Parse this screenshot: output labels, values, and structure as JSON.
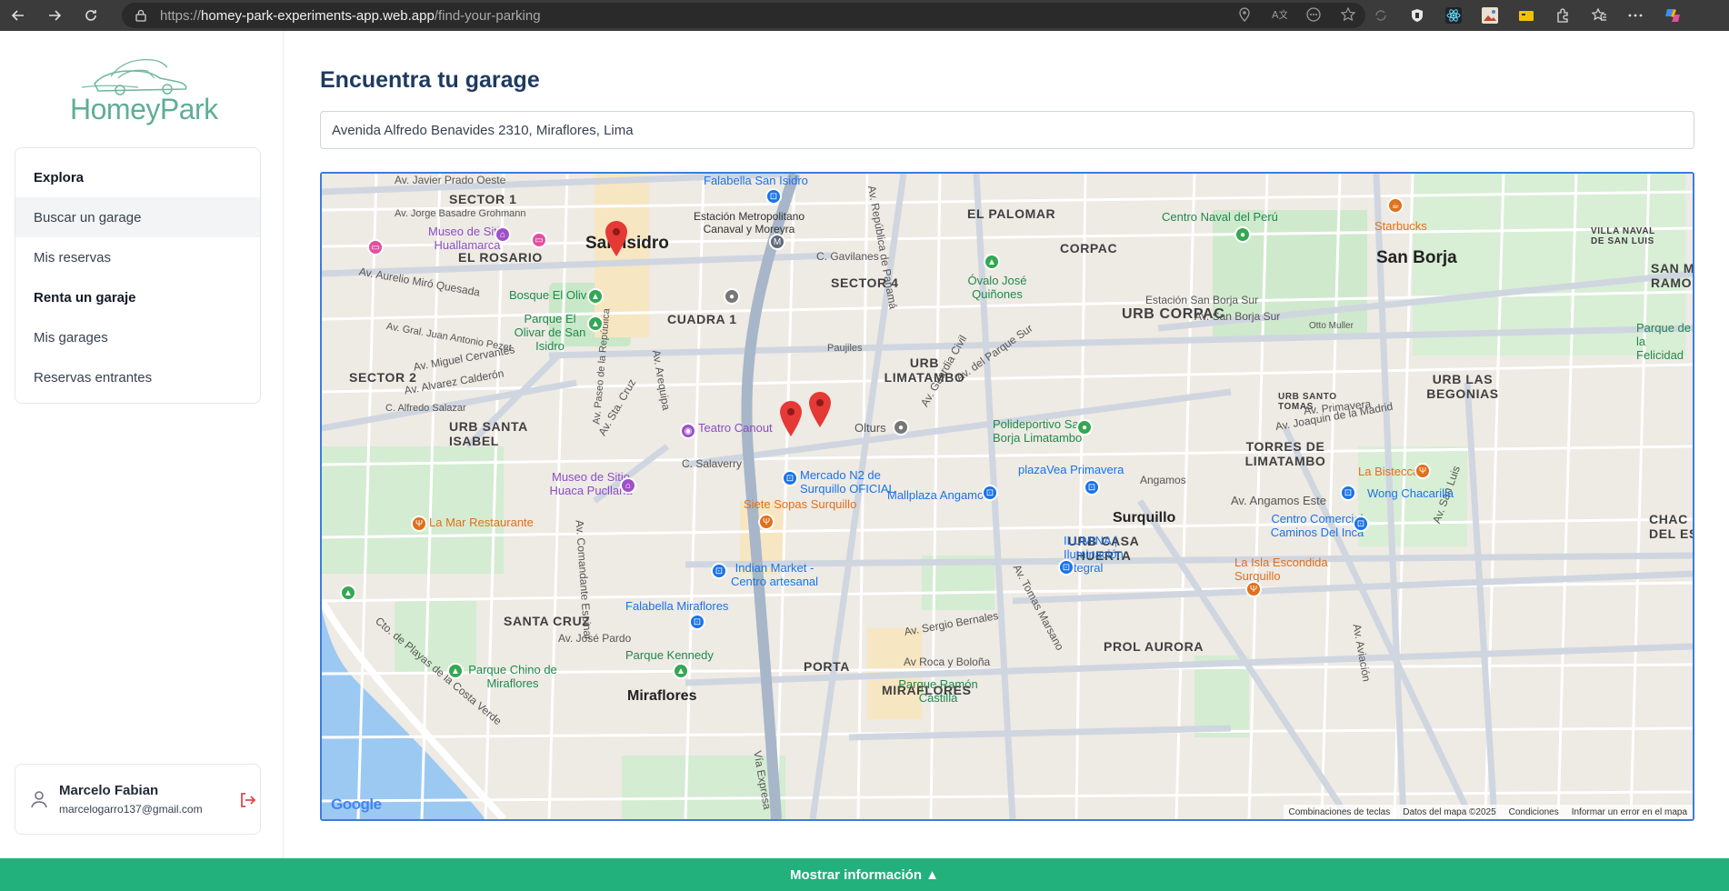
{
  "browser": {
    "url_prefix": "https://",
    "url_host": "homey-park-experiments-app.web.app",
    "url_path": "/find-your-parking"
  },
  "sidebar": {
    "logo_text": "HomeyPark",
    "sections": [
      {
        "label": "Explora"
      },
      {
        "label": "Buscar un garage"
      },
      {
        "label": "Mis reservas"
      },
      {
        "label": "Renta un garaje"
      },
      {
        "label": "Mis garages"
      },
      {
        "label": "Reservas entrantes"
      }
    ],
    "user": {
      "name": "Marcelo Fabian",
      "email": "marcelogarro137@gmail.com"
    }
  },
  "main": {
    "title": "Encuentra tu garage",
    "search_value": "Avenida Alfredo Benavides 2310, Miraflores, Lima"
  },
  "map": {
    "districts": [
      "San Isidro",
      "San Borja",
      "Surquillo",
      "Miraflores"
    ],
    "areas": [
      "SECTOR 1",
      "EL ROSARIO",
      "SECTOR 4",
      "CUADRA 1",
      "URB LIMATAMBO",
      "EL PALOMAR",
      "CORPAC",
      "URB CORPAC",
      "URB SANTA ISABEL",
      "SECTOR 2",
      "TORRES DE LIMATAMBO",
      "URB CASA HUERTA",
      "URB LAS BEGONIAS",
      "SANTA CRUZ",
      "PROL AURORA",
      "PORTA",
      "MIRAFLORES",
      "URB SANTO TOMAS",
      "VILLA NAVAL DE SAN LUIS",
      "CHAC DEL ES",
      "SAN MA RAMON"
    ],
    "streets": [
      "Av. Javier Prado Oeste",
      "Av. Jorge Basadre Grohmann",
      "Av. Aurelio Miró Quesada",
      "Av. Gral. Juan Antonio Pezet",
      "Av. Miguel Cervantes",
      "Av. Alvarez Calderón",
      "C. Alfredo Salazar",
      "Av. Arequipa",
      "Av. República de Panamá",
      "Vía Expresa",
      "C. Salaverry",
      "Av. Angamos Este",
      "Av. Tomas Marsano",
      "Av. Aviación",
      "Av. San Luis",
      "Av. Joaquin de la Madrid",
      "Estación San Borja Sur",
      "Av. San Borja Sur",
      "Av. del Parque Sur",
      "Av. Guardia Civil",
      "C. Gavilanes",
      "Paujiles",
      "Av. José Pardo",
      "Av Roca y Boloña",
      "Av. Sergio Bernales",
      "Av. Comandante Espinar",
      "Cto. de Playas de la Costa Verde",
      "Av. Sta. Cruz",
      "Av. Paseo de la República",
      "Av. Primavera"
    ],
    "pois": [
      {
        "label": "Falabella San Isidro",
        "color": "blue"
      },
      {
        "label": "Estación Metropolitano Canaval y Moreyra",
        "color": "gray"
      },
      {
        "label": "Museo de Sitio Huallamarca",
        "color": "purple"
      },
      {
        "label": "Bosque El Olivar",
        "color": "green"
      },
      {
        "label": "Parque El Olivar de San Isidro",
        "color": "green"
      },
      {
        "label": "Teatro Canout",
        "color": "purple"
      },
      {
        "label": "Museo de Sitio Huaca Pucllana",
        "color": "purple"
      },
      {
        "label": "Mercado N2 de Surquillo OFICIAL",
        "color": "blue"
      },
      {
        "label": "Siete Sopas Surquillo",
        "color": "orange"
      },
      {
        "label": "Mallplaza Angamos",
        "color": "blue"
      },
      {
        "label": "plazaVea Primavera",
        "color": "blue"
      },
      {
        "label": "Polideportivo San Borja Limatambo",
        "color": "green"
      },
      {
        "label": "Óvalo José Quiñones",
        "color": "green"
      },
      {
        "label": "Centro Naval del Perú",
        "color": "green"
      },
      {
        "label": "Starbucks",
        "color": "orange"
      },
      {
        "label": "Parque de la Felicidad",
        "color": "green"
      },
      {
        "label": "La Bistecca",
        "color": "orange"
      },
      {
        "label": "Wong Chacarilla",
        "color": "blue"
      },
      {
        "label": "Centro Comercial Caminos Del Inca",
        "color": "blue"
      },
      {
        "label": "La Isla Escondida Surquillo",
        "color": "orange"
      },
      {
        "label": "ILUMINA | Iluminación Integral",
        "color": "blue"
      },
      {
        "label": "La Mar Restaurante",
        "color": "orange"
      },
      {
        "label": "Indian Market - Centro artesanal",
        "color": "blue"
      },
      {
        "label": "Falabella Miraflores",
        "color": "blue"
      },
      {
        "label": "Parque Kennedy",
        "color": "green"
      },
      {
        "label": "Parque Chino de Miraflores",
        "color": "green"
      },
      {
        "label": "Parque Ramón Castilla",
        "color": "green"
      },
      {
        "label": "Olturs",
        "color": "gray"
      },
      {
        "label": "Angamos",
        "color": "gray"
      },
      {
        "label": "Otto Muller",
        "color": "gray"
      }
    ],
    "attribution": [
      "Combinaciones de teclas",
      "Datos del mapa ©2025",
      "Condiciones",
      "Informar un error en el mapa"
    ],
    "google": "Google"
  },
  "bottom_bar": {
    "label": "Mostrar información ▲"
  }
}
